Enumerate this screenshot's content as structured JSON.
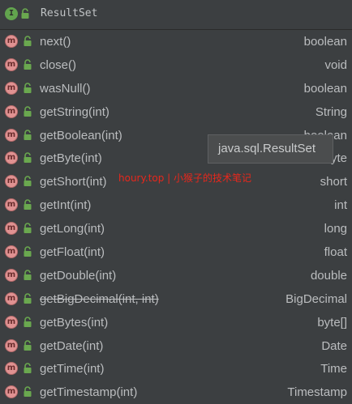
{
  "header": {
    "icon_letter": "I",
    "title": "ResultSet"
  },
  "colors": {
    "interface_badge": "#62a44e",
    "method_badge": "#e09292",
    "lock": "#6aa84f",
    "watermark": "#e8271c"
  },
  "methods": [
    {
      "name": "next()",
      "type": "boolean"
    },
    {
      "name": "close()",
      "type": "void"
    },
    {
      "name": "wasNull()",
      "type": "boolean"
    },
    {
      "name": "getString(int)",
      "type": "String"
    },
    {
      "name": "getBoolean(int)",
      "type": "boolean"
    },
    {
      "name": "getByte(int)",
      "type": "byte"
    },
    {
      "name": "getShort(int)",
      "type": "short"
    },
    {
      "name": "getInt(int)",
      "type": "int"
    },
    {
      "name": "getLong(int)",
      "type": "long"
    },
    {
      "name": "getFloat(int)",
      "type": "float"
    },
    {
      "name": "getDouble(int)",
      "type": "double"
    },
    {
      "name": "getBigDecimal(int, int)",
      "type": "BigDecimal",
      "deprecated": true
    },
    {
      "name": "getBytes(int)",
      "type": "byte[]"
    },
    {
      "name": "getDate(int)",
      "type": "Date"
    },
    {
      "name": "getTime(int)",
      "type": "Time"
    },
    {
      "name": "getTimestamp(int)",
      "type": "Timestamp"
    }
  ],
  "method_icon_letter": "m",
  "tooltip": "java.sql.ResultSet",
  "watermark": "houry.top | 小猴子的技术笔记"
}
